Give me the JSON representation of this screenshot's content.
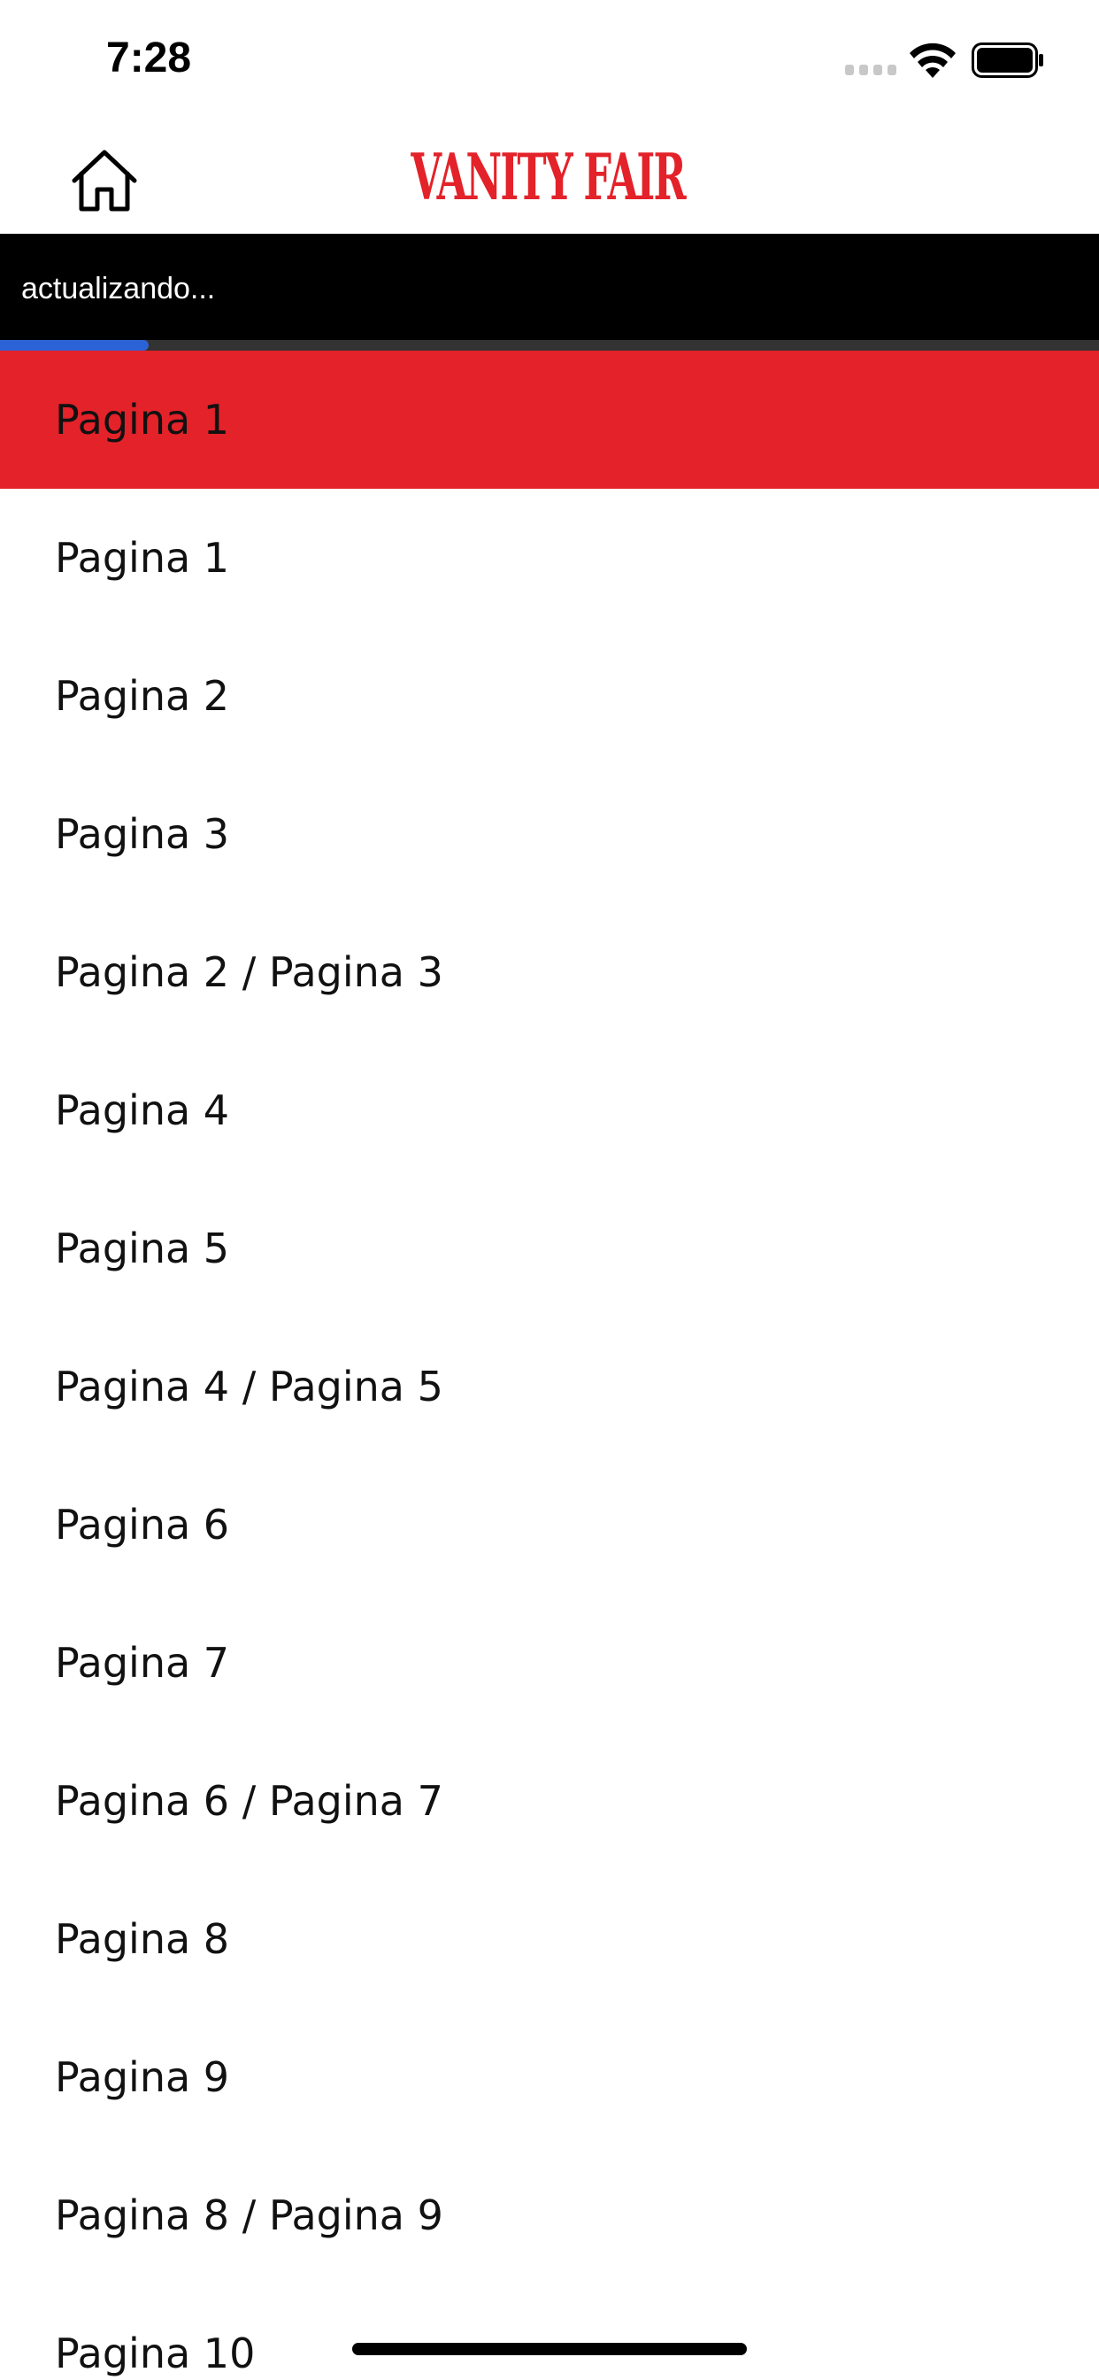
{
  "status_bar": {
    "time": "7:28",
    "icons": [
      "signal-icon",
      "wifi-icon",
      "battery-icon"
    ]
  },
  "header": {
    "home_icon": "home-icon",
    "logo_text": "VANITY FAIR",
    "logo_color": "#e32229"
  },
  "updating": {
    "text": "actualizando...",
    "progress_fraction": 0.135,
    "progress_color": "#2b63d6"
  },
  "pages": {
    "active_index": 0,
    "active_color": "#e32229",
    "items": [
      "Pagina 1",
      "Pagina 1",
      "Pagina 2",
      "Pagina 3",
      "Pagina 2 / Pagina 3",
      "Pagina 4",
      "Pagina 5",
      "Pagina 4 / Pagina 5",
      "Pagina 6",
      "Pagina 7",
      "Pagina 6 / Pagina 7",
      "Pagina 8",
      "Pagina 9",
      "Pagina 8 / Pagina 9",
      "Pagina 10"
    ]
  }
}
